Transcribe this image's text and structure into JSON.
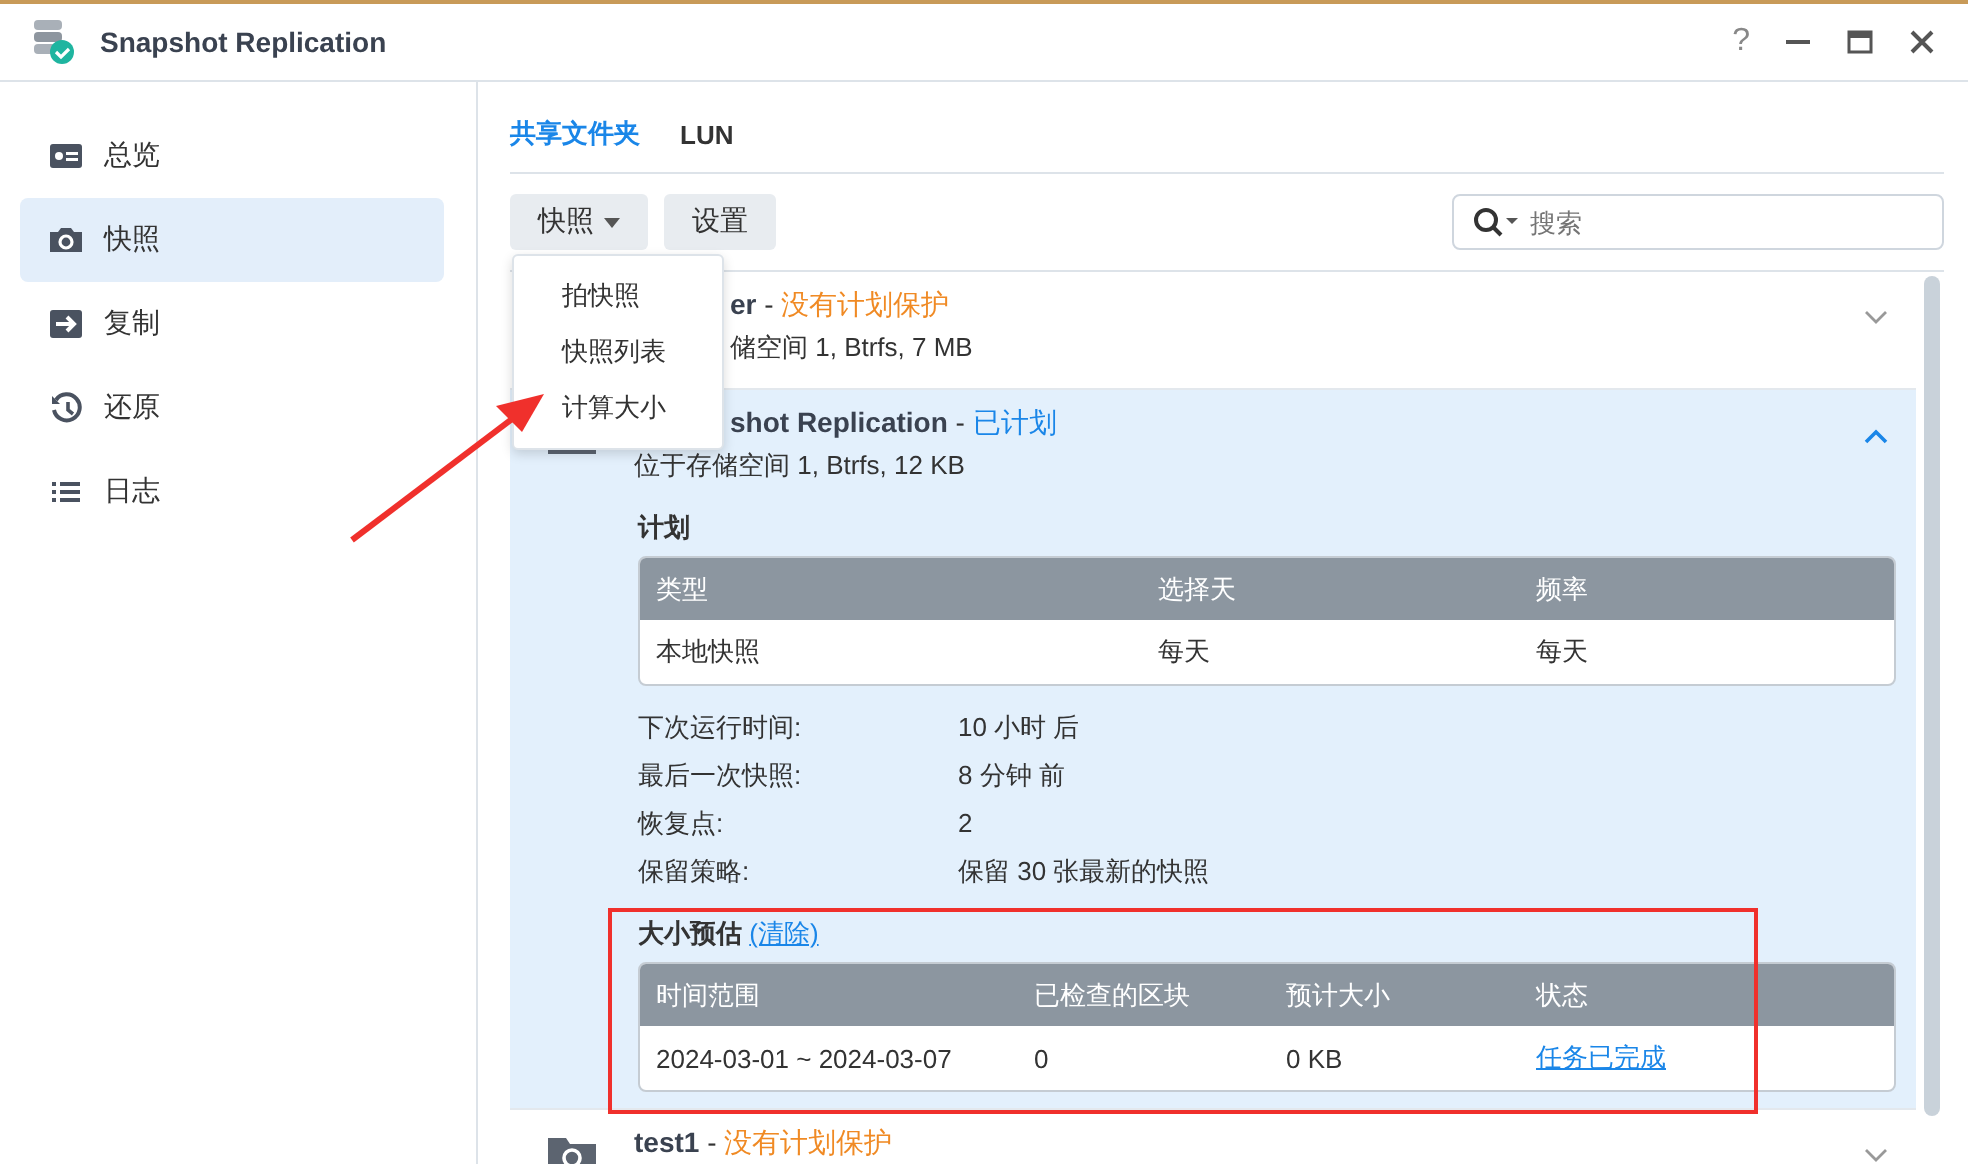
{
  "window": {
    "title": "Snapshot Replication",
    "help": "?"
  },
  "sidebar": {
    "items": [
      {
        "label": "总览",
        "selected": false
      },
      {
        "label": "快照",
        "selected": true
      },
      {
        "label": "复制",
        "selected": false
      },
      {
        "label": "还原",
        "selected": false
      },
      {
        "label": "日志",
        "selected": false
      }
    ]
  },
  "tabs": [
    {
      "label": "共享文件夹",
      "selected": true
    },
    {
      "label": "LUN",
      "selected": false
    }
  ],
  "toolbar": {
    "buttons": [
      {
        "label": "快照",
        "dropdown": true
      },
      {
        "label": "设置",
        "dropdown": false
      }
    ],
    "search": {
      "placeholder": "搜索"
    }
  },
  "menu": {
    "items": [
      "拍快照",
      "快照列表",
      "计算大小"
    ]
  },
  "shares": [
    {
      "name": "er",
      "name_covered": true,
      "separator": "-",
      "status": "没有计划保护",
      "scheduled": false,
      "location": "储空间 1, Btrfs, 7 MB",
      "location_covered": true,
      "expanded": false
    },
    {
      "name": "shot Replication",
      "name_covered": true,
      "separator": "-",
      "status": "已计划",
      "scheduled": true,
      "location": "位于存储空间 1, Btrfs, 12 KB",
      "location_covered": false,
      "expanded": true,
      "details": {
        "plan_title": "计划",
        "plan_columns": [
          "类型",
          "选择天",
          "频率"
        ],
        "plan_rows": [
          [
            "本地快照",
            "每天",
            "每天"
          ]
        ],
        "info": [
          {
            "label": "下次运行时间:",
            "value": "10 小时 后"
          },
          {
            "label": "最后一次快照:",
            "value": "8 分钟 前"
          },
          {
            "label": "恢复点:",
            "value": "2"
          },
          {
            "label": "保留策略:",
            "value": "保留 30 张最新的快照"
          }
        ],
        "estimate_title": "大小预估",
        "clear_link": "(清除)",
        "estimate_columns": [
          "时间范围",
          "已检查的区块",
          "预计大小",
          "状态"
        ],
        "estimate_rows": [
          {
            "cells": [
              "2024-03-01 ~ 2024-03-07",
              "0",
              "0 KB"
            ],
            "status": "任务已完成"
          }
        ]
      }
    },
    {
      "name": "test1",
      "name_covered": false,
      "separator": "-",
      "status": "没有计划保护",
      "scheduled": false,
      "expanded": false
    }
  ]
}
